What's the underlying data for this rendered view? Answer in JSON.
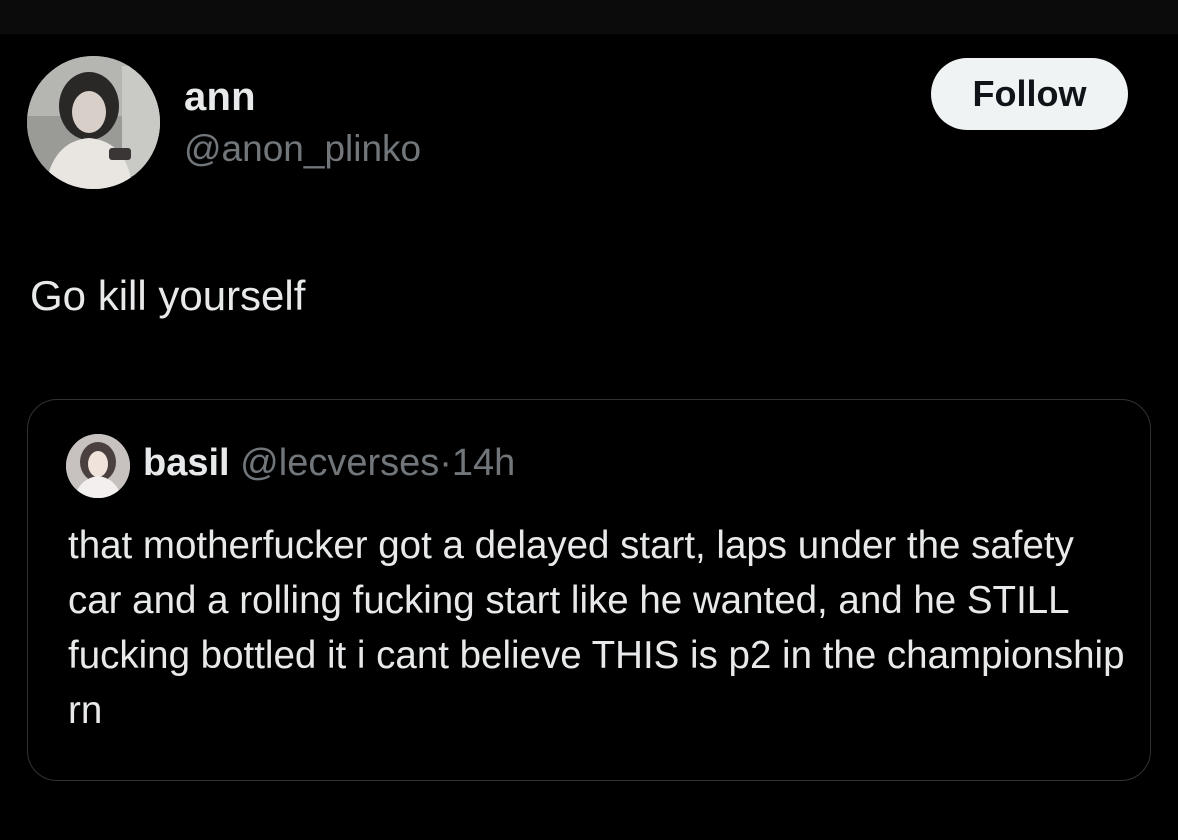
{
  "tweet": {
    "author": {
      "display_name": "ann",
      "handle": "@anon_plinko"
    },
    "follow_label": "Follow",
    "text": "Go kill yourself"
  },
  "quoted_tweet": {
    "author": {
      "display_name": "basil",
      "handle": "@lecverses"
    },
    "separator": "·",
    "time": "14h",
    "text": "that motherfucker got a delayed start, laps under the safety car and a rolling fucking start like he wanted, and he STILL fucking bottled it i cant believe THIS is p2 in the championship rn"
  },
  "colors": {
    "background": "#000000",
    "primary_text": "#e7e9ea",
    "secondary_text": "#71767b",
    "follow_button_bg": "#eff3f4",
    "quote_border": "#2f3336"
  }
}
